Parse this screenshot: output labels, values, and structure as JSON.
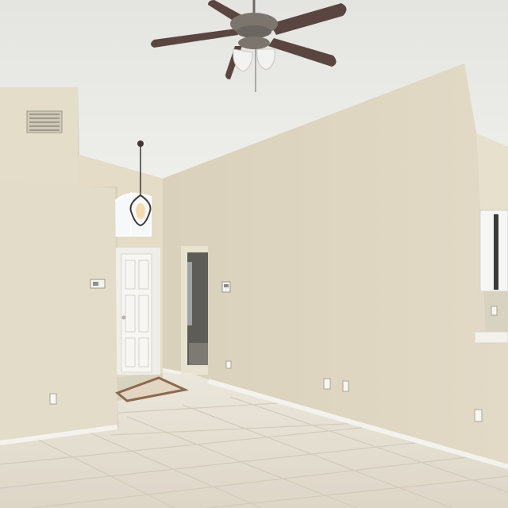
{
  "scene": {
    "subject": "empty-room-interior",
    "colors": {
      "ceiling": "#e9e9e6",
      "wall_main": "#ddd5c0",
      "wall_shadow": "#cfc7b1",
      "wall_left": "#e2dcc8",
      "baseboard": "#f4f2ee",
      "floor": "#e3ddd0",
      "floor_grout": "#cfc7b7",
      "door": "#f7f6f3",
      "fan_metal": "#6f6a63",
      "fan_blade": "#5a4540",
      "window_glass": "#f6f8fa",
      "hallway_dark": "#5e5c57"
    }
  }
}
